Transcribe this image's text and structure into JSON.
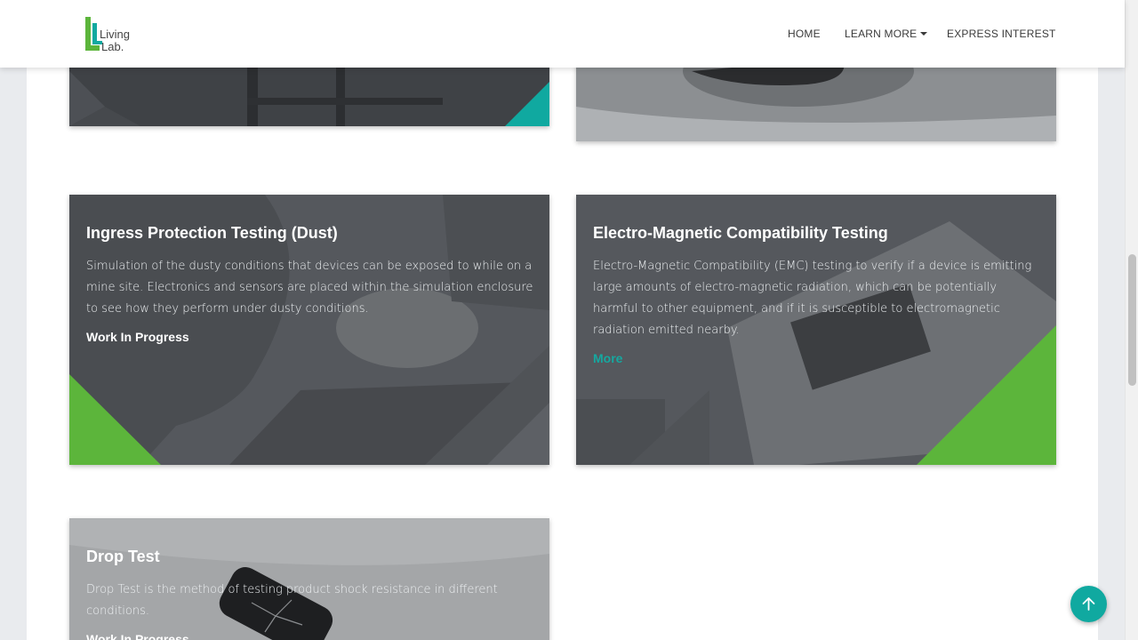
{
  "nav": {
    "logo_text_1": "Living",
    "logo_text_2": "Lab.",
    "home": "HOME",
    "learn_more": "LEARN MORE",
    "express_interest": "EXPRESS INTEREST"
  },
  "cards": [
    {
      "title": "Ingress Protection Testing (Dust)",
      "description": "Simulation of the dusty conditions that devices can be exposed to while on a mine site. Electronics and sensors are placed within the simulation enclosure to see how they perform under dusty conditions.",
      "status": "Work In Progress"
    },
    {
      "title": "Electro-Magnetic Compatibility Testing",
      "description": "Electro-Magnetic Compatibility (EMC) testing to verify if a device is emitting large amounts of electro-magnetic radiation, which can be potentially harmful to other equipment, and if it is susceptible to electromagnetic radiation emitted nearby.",
      "link": "More"
    },
    {
      "title": "Drop Test",
      "description": "Drop Test is the method of testing product shock resistance in different conditions.",
      "status": "Work In Progress"
    }
  ],
  "icons": {
    "scroll_top": "arrow-up-icon"
  },
  "colors": {
    "accent_teal": "#10a9a0",
    "accent_green": "#5cb53b",
    "card_overlay": "#3a3d42"
  }
}
